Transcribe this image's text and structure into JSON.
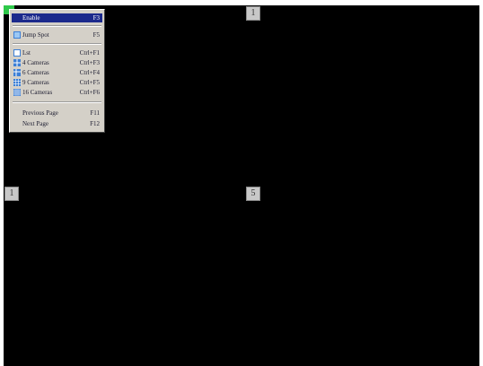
{
  "screen": {
    "channel_tags": {
      "top": "1",
      "left": "1",
      "center": "5"
    }
  },
  "menu": {
    "items": [
      {
        "label": "Enable",
        "shortcut": "F3",
        "icon": "none",
        "highlight": true
      },
      {
        "label": "Jump Spot",
        "shortcut": "F5",
        "icon": "jump-spot-icon"
      },
      {
        "label": "Lst",
        "shortcut": "Ctrl+F1",
        "icon": "single-view-icon"
      },
      {
        "label": "4 Cameras",
        "shortcut": "Ctrl+F3",
        "icon": "quad-view-icon"
      },
      {
        "label": "6 Cameras",
        "shortcut": "Ctrl+F4",
        "icon": "six-view-icon"
      },
      {
        "label": "9 Cameras",
        "shortcut": "Ctrl+F5",
        "icon": "nine-view-icon"
      },
      {
        "label": "16 Cameras",
        "shortcut": "Ctrl+F6",
        "icon": "sixteen-view-icon"
      },
      {
        "label": "Previous Page",
        "shortcut": "F11",
        "icon": "none"
      },
      {
        "label": "Next Page",
        "shortcut": "F12",
        "icon": "none"
      }
    ]
  },
  "colors": {
    "screen_bg": "#000000",
    "menu_bg": "#d4d0c8",
    "highlight": "#1c2a8c",
    "marker": "#2fc94a"
  }
}
